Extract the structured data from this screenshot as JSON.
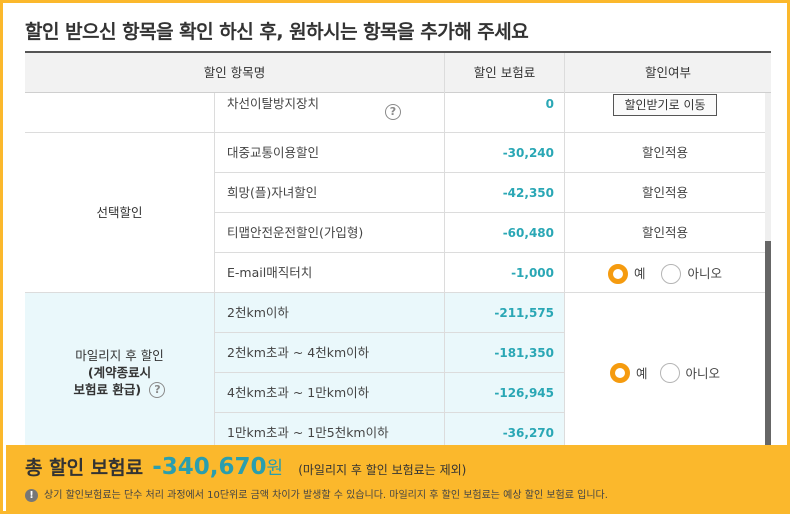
{
  "page": {
    "heading": "할인 받으신 항목을 확인 하신 후, 원하시는 항목을 추가해 주세요"
  },
  "table": {
    "headers": {
      "item": "할인 항목명",
      "premium": "할인 보험료",
      "status": "할인여부"
    },
    "top_row": {
      "name": "차선이탈방지장치",
      "amount": "0",
      "button": "할인받기로 이동"
    },
    "optional_group": {
      "label": "선택할인",
      "rows": [
        {
          "name": "대중교통이용할인",
          "amount": "-30,240",
          "status": "할인적용"
        },
        {
          "name": "희망(플)자녀할인",
          "amount": "-42,350",
          "status": "할인적용"
        },
        {
          "name": "티맵안전운전할인(가입형)",
          "amount": "-60,480",
          "status": "할인적용"
        }
      ],
      "email_row": {
        "name": "E-mail매직터치",
        "amount": "-1,000",
        "yes": "예",
        "no": "아니오",
        "selected": "yes"
      }
    },
    "mileage_group": {
      "label_line1": "마일리지 후 할인",
      "label_line2": "(계약종료시",
      "label_line3": "보험료 환급)",
      "rows": [
        {
          "name": "2천km이하",
          "amount": "-211,575"
        },
        {
          "name": "2천km초과 ~ 4천km이하",
          "amount": "-181,350"
        },
        {
          "name": "4천km초과 ~ 1만km이하",
          "amount": "-126,945"
        },
        {
          "name": "1만km초과 ~ 1만5천km이하",
          "amount": "-36,270"
        }
      ],
      "yes": "예",
      "no": "아니오",
      "selected": "yes"
    }
  },
  "footer": {
    "total_label": "총 할인 보험료",
    "total_value": "-340,670",
    "total_unit": "원",
    "total_note": "(마일리지 후 할인 보험료는 제외)",
    "notice": "상기 할인보험료는 단수 처리 과정에서 10단위로 금액 차이가 발생할 수 있습니다. 마일리지 후 할인 보험료는 예상 할인 보험료 입니다."
  },
  "colors": {
    "accent": "#fbb82c",
    "amount": "#2aa7b5",
    "radio_on": "#f59b0f",
    "mileage_bg": "#eaf8fb"
  }
}
